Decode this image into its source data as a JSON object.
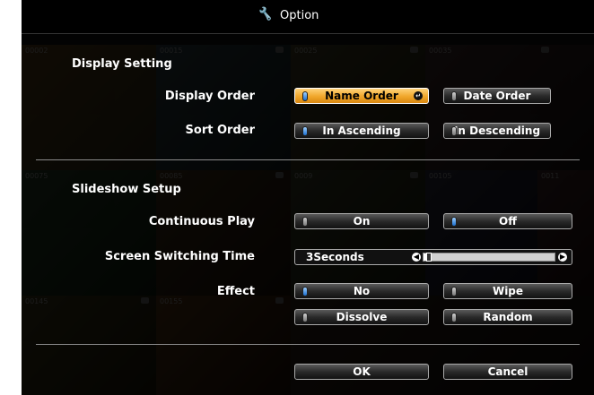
{
  "window": {
    "title": "Option",
    "title_icon": "wrench-screwdriver-icon"
  },
  "background_thumbnails": [
    {
      "num": "00002"
    },
    {
      "num": "00015"
    },
    {
      "num": "00025"
    },
    {
      "num": "00035"
    },
    {
      "num": "00075"
    },
    {
      "num": "00085"
    },
    {
      "num": "0009"
    },
    {
      "num": "00105"
    },
    {
      "num": "0011"
    },
    {
      "num": "00145"
    },
    {
      "num": "00155"
    }
  ],
  "display_setting": {
    "label": "Display Setting",
    "display_order": {
      "label": "Display Order",
      "options": [
        {
          "label": "Name Order",
          "selected": true
        },
        {
          "label": "Date Order",
          "selected": false
        }
      ]
    },
    "sort_order": {
      "label": "Sort Order",
      "options": [
        {
          "label": "In Ascending",
          "selected": true
        },
        {
          "label": "In Descending",
          "selected": false
        }
      ]
    }
  },
  "slideshow_setup": {
    "label": "Slideshow Setup",
    "continuous_play": {
      "label": "Continuous Play",
      "options": [
        {
          "label": "On",
          "selected": false
        },
        {
          "label": "Off",
          "selected": true
        }
      ]
    },
    "screen_switching_time": {
      "label": "Screen Switching Time",
      "value": "3Seconds",
      "level": 0.02
    },
    "effect": {
      "label": "Effect",
      "options": [
        {
          "label": "No",
          "selected": true
        },
        {
          "label": "Wipe",
          "selected": false
        },
        {
          "label": "Dissolve",
          "selected": false
        },
        {
          "label": "Random",
          "selected": false
        }
      ]
    }
  },
  "footer": {
    "ok_label": "OK",
    "cancel_label": "Cancel"
  },
  "colors": {
    "selected_button": "#f0a72a",
    "radio_on": "#1a6fd1"
  }
}
